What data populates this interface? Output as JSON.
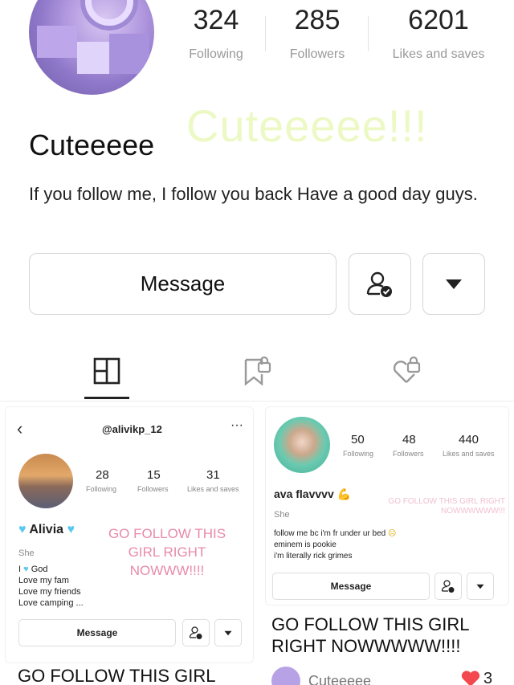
{
  "profile": {
    "stats": [
      {
        "num": "324",
        "label": "Following"
      },
      {
        "num": "285",
        "label": "Followers"
      },
      {
        "num": "6201",
        "label": "Likes and saves"
      }
    ],
    "name": "Cuteeeee",
    "watermark": "Cuteeeee!!!",
    "bio": "If you follow me, I follow you back  Have a good day guys.",
    "message_label": "Message"
  },
  "tabs": [
    {
      "name": "posts",
      "icon": "grid-icon"
    },
    {
      "name": "saved",
      "icon": "bookmark-lock-icon"
    },
    {
      "name": "liked",
      "icon": "heart-lock-icon"
    }
  ],
  "post1": {
    "handle": "@alivikp_12",
    "stats": [
      {
        "num": "28",
        "label": "Following"
      },
      {
        "num": "15",
        "label": "Followers"
      },
      {
        "num": "31",
        "label": "Likes and saves"
      }
    ],
    "name": "Alivia",
    "pronoun": "She",
    "overlay": "GO FOLLOW THIS GIRL RIGHT NOWWW!!!!",
    "bio_lines": [
      "God",
      "Love my fam",
      "Love my friends",
      "Love camping ..."
    ],
    "message_label": "Message",
    "caption": "GO FOLLOW  THIS GIRL"
  },
  "post2": {
    "stats": [
      {
        "num": "50",
        "label": "Following"
      },
      {
        "num": "48",
        "label": "Followers"
      },
      {
        "num": "440",
        "label": "Likes and saves"
      }
    ],
    "name": "ava flavvvv",
    "pronoun": "She",
    "overlay": "GO FOLLOW THIS GIRL RIGHT NOWWWWWW!!!",
    "bio_lines": [
      "follow me bc i'm fr under ur bed",
      "eminem is pookie",
      "i'm literally rick grimes"
    ],
    "message_label": "Message",
    "caption": "GO FOLLOW THIS GIRL RIGHT NOWWWWW!!!!",
    "author": "Cuteeeee",
    "likes": "3"
  }
}
